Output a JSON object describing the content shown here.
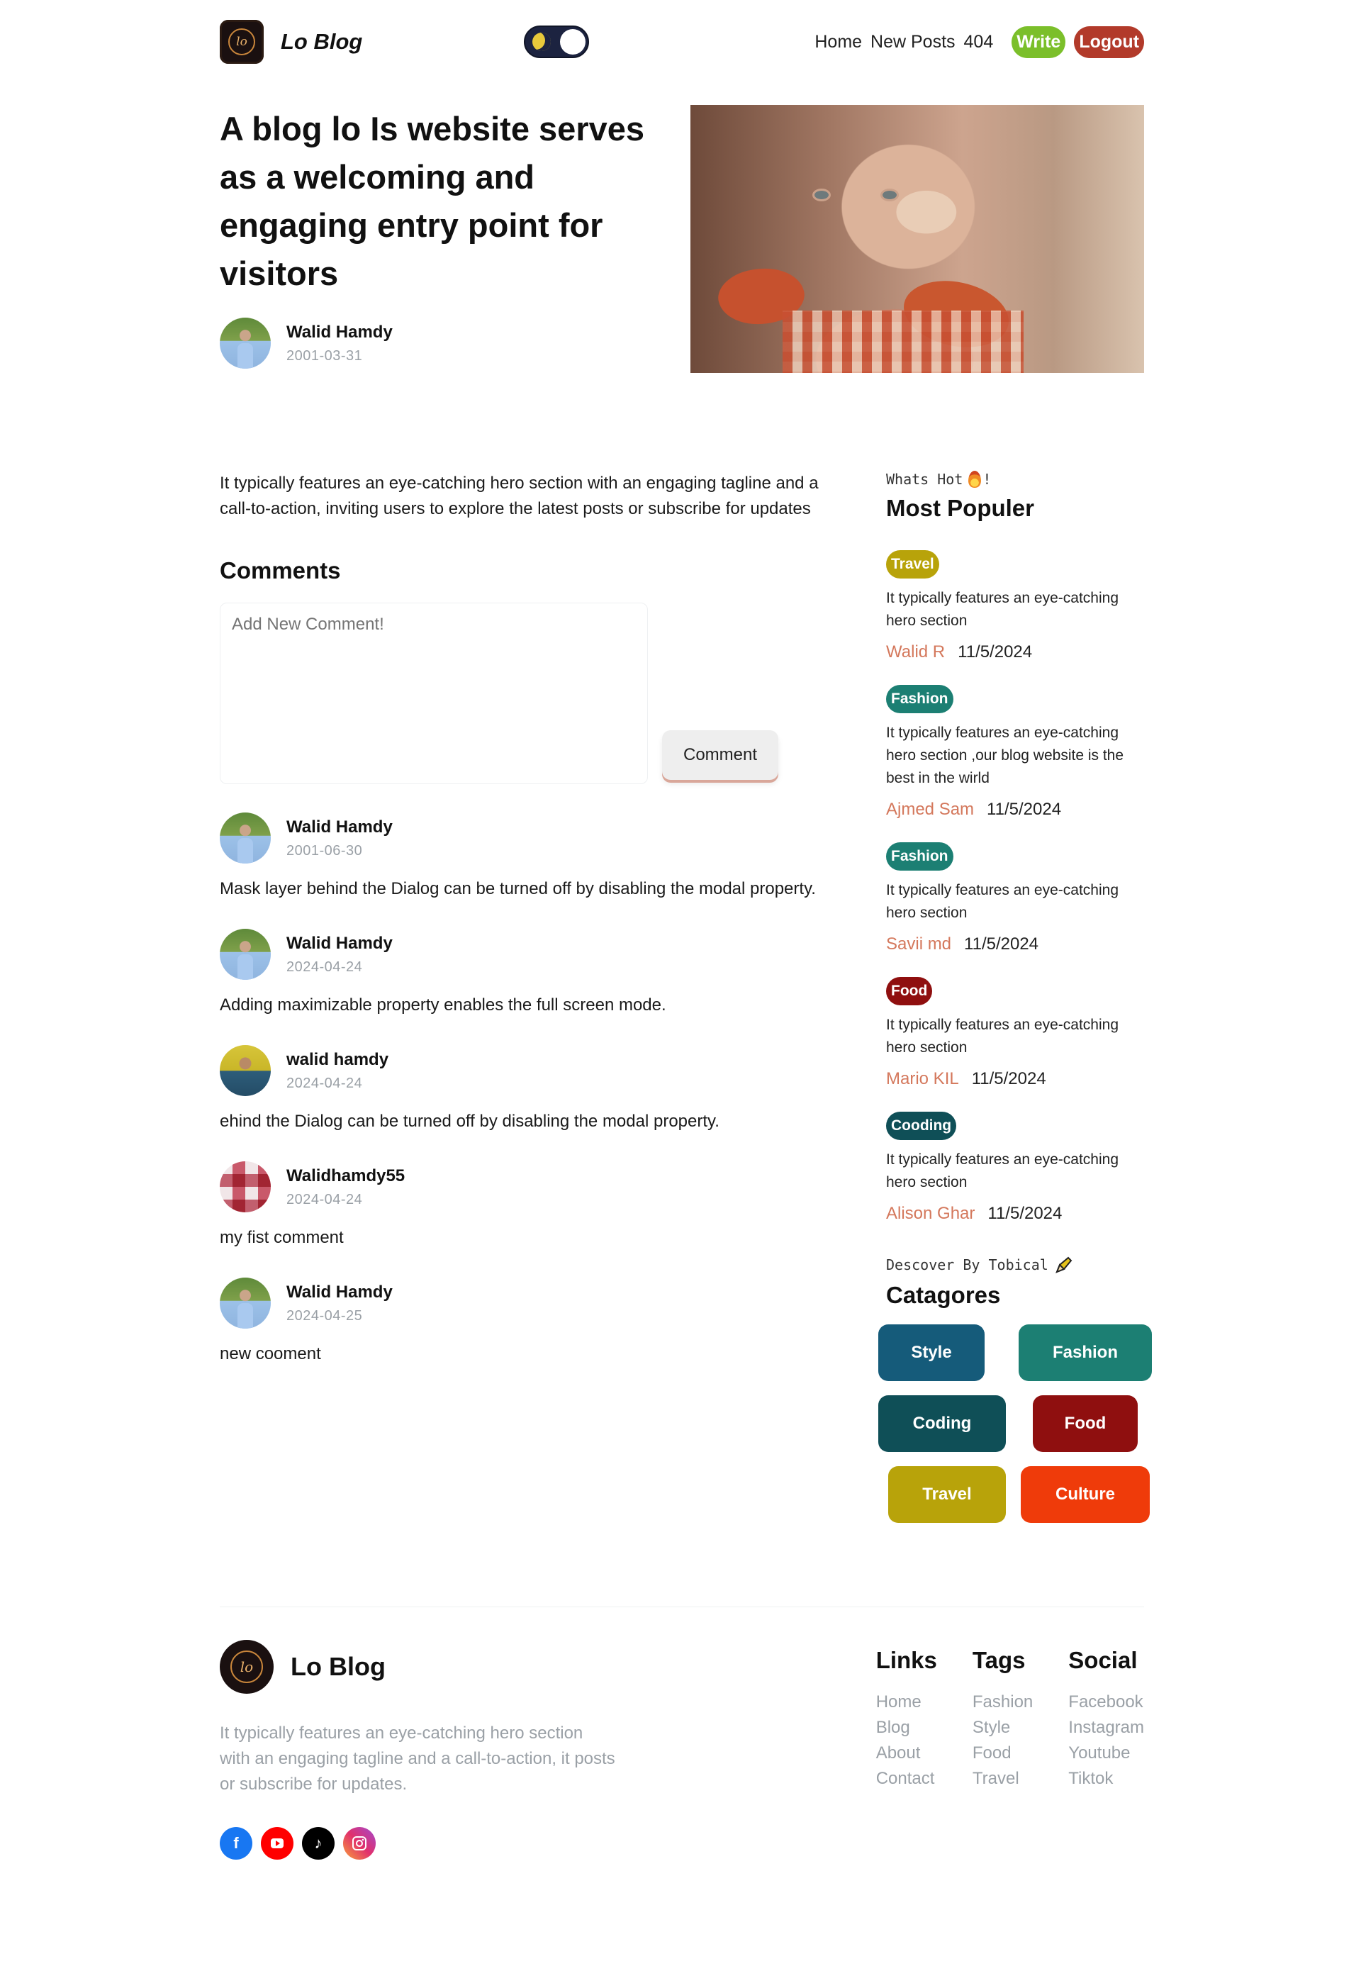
{
  "header": {
    "brand": "Lo Blog",
    "logo_text": "lo",
    "nav": [
      "Home",
      "New Posts",
      "404"
    ],
    "write_label": "Write",
    "logout_label": "Logout",
    "colors": {
      "write": "#7bbf2a",
      "logout": "#b23a2a",
      "toggle": "#1c2340"
    }
  },
  "hero": {
    "title": "A blog lo Is website serves as a welcoming and engaging entry point for visitors",
    "author": {
      "name": "Walid Hamdy",
      "date": "2001-03-31"
    }
  },
  "post": {
    "intro": "It typically features an eye-catching hero section with an engaging tagline and a call-to-action, inviting users to explore the latest posts or subscribe for updates"
  },
  "comments": {
    "title": "Comments",
    "placeholder": "Add New Comment!",
    "button_label": "Comment",
    "items": [
      {
        "name": "Walid Hamdy",
        "date": "2001-06-30",
        "text": "Mask layer behind the Dialog can be turned off by disabling the modal property."
      },
      {
        "name": "Walid Hamdy",
        "date": "2024-04-24",
        "text": "Adding maximizable property enables the full screen mode."
      },
      {
        "name": "walid hamdy",
        "date": "2024-04-24",
        "text": "ehind the Dialog can be turned off by disabling the modal property."
      },
      {
        "name": "Walidhamdy55",
        "date": "2024-04-24",
        "text": "my fist comment"
      },
      {
        "name": "Walid Hamdy",
        "date": "2024-04-25",
        "text": "new cooment"
      }
    ]
  },
  "sidebar": {
    "popular": {
      "kicker": "Whats Hot",
      "kicker_suffix": "!",
      "title": "Most Populer",
      "items": [
        {
          "tag": "Travel",
          "tag_color": "#b8a30a",
          "text": "It typically features an eye-catching hero section",
          "author": "Walid R",
          "date": "11/5/2024"
        },
        {
          "tag": "Fashion",
          "tag_color": "#1c7f73",
          "text": "It typically features an eye-catching hero section ,our blog website is the best in the wirld",
          "author": "Ajmed Sam",
          "date": "11/5/2024"
        },
        {
          "tag": "Fashion",
          "tag_color": "#1c7f73",
          "text": "It typically features an eye-catching hero section",
          "author": "Savii md",
          "date": "11/5/2024"
        },
        {
          "tag": "Food",
          "tag_color": "#8f0f0f",
          "text": "It typically features an eye-catching hero section",
          "author": "Mario KIL",
          "date": "11/5/2024"
        },
        {
          "tag": "Cooding",
          "tag_color": "#0f4f57",
          "text": "It typically features an eye-catching hero section",
          "author": "Alison Ghar",
          "date": "11/5/2024"
        }
      ]
    },
    "categories": {
      "kicker": "Descover By Tobical",
      "title": "Catagores",
      "items": [
        {
          "label": "Style",
          "color": "#155b7a"
        },
        {
          "label": "Fashion",
          "color": "#1c7f73"
        },
        {
          "label": "Coding",
          "color": "#0f4f57"
        },
        {
          "label": "Food",
          "color": "#8f0f0f"
        },
        {
          "label": "Travel",
          "color": "#b8a30a"
        },
        {
          "label": "Culture",
          "color": "#ef3b0a"
        }
      ]
    }
  },
  "footer": {
    "brand": "Lo Blog",
    "logo_text": "lo",
    "description": "It typically features an eye-catching hero section with an engaging tagline and a call-to-action, it posts or subscribe for updates.",
    "socials": [
      "facebook-icon",
      "youtube-icon",
      "tiktok-icon",
      "instagram-icon"
    ],
    "columns": [
      {
        "title": "Links",
        "items": [
          "Home",
          "Blog",
          "About",
          "Contact"
        ]
      },
      {
        "title": "Tags",
        "items": [
          "Fashion",
          "Style",
          "Food",
          "Travel"
        ]
      },
      {
        "title": "Social",
        "items": [
          "Facebook",
          "Instagram",
          "Youtube",
          "Tiktok"
        ]
      }
    ]
  }
}
